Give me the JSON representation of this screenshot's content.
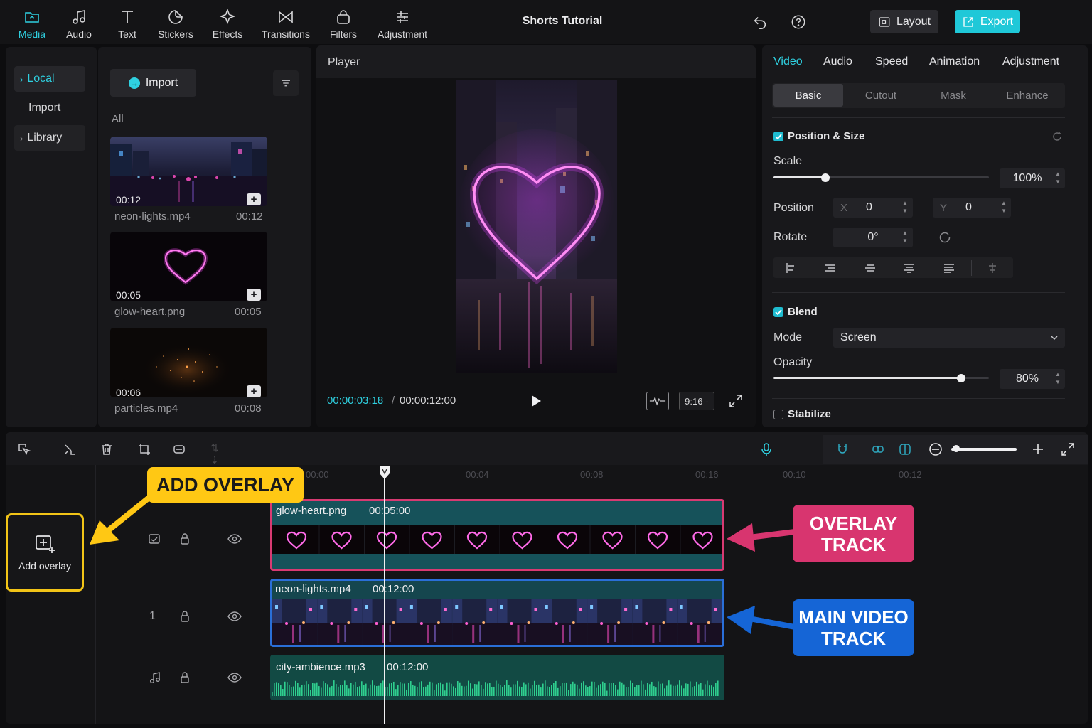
{
  "toolbar": {
    "items": [
      {
        "label": "Media",
        "icon": "folder-icon"
      },
      {
        "label": "Audio",
        "icon": "music-note-icon"
      },
      {
        "label": "Text",
        "icon": "text-icon"
      },
      {
        "label": "Stickers",
        "icon": "sticker-icon"
      },
      {
        "label": "Effects",
        "icon": "sparkle-icon"
      },
      {
        "label": "Transitions",
        "icon": "bowtie-icon"
      },
      {
        "label": "Filters",
        "icon": "filter-icon"
      },
      {
        "label": "Adjustment",
        "icon": "sliders-icon"
      }
    ],
    "title": "Shorts Tutorial",
    "layout_label": "Layout",
    "export_label": "Export"
  },
  "media_sidebar": {
    "local": "Local",
    "import": "Import",
    "library": "Library"
  },
  "media_panel": {
    "import_button": "Import",
    "filter_label": "All",
    "items": [
      {
        "thumb_time": "00:12",
        "name": "neon-lights.mp4",
        "duration": "00:12"
      },
      {
        "thumb_time": "00:05",
        "name": "glow-heart.png",
        "duration": "00:05"
      },
      {
        "thumb_time": "00:06",
        "name": "particles.mp4",
        "duration": "00:08"
      }
    ]
  },
  "player": {
    "title": "Player",
    "current_time": "00:00:03:18",
    "separator": "/",
    "total_time": "00:00:12:00",
    "ratio": "9:16"
  },
  "properties": {
    "tabs": [
      "Video",
      "Audio",
      "Speed",
      "Animation",
      "Adjustment"
    ],
    "subtabs": [
      "Basic",
      "Cutout",
      "Mask",
      "Enhance"
    ],
    "position_size": "Position & Size",
    "scale_label": "Scale",
    "scale_value": "100%",
    "scale_fraction": 0.24,
    "position_label": "Position",
    "x_label": "X",
    "x_value": "0",
    "y_label": "Y",
    "y_value": "0",
    "rotate_label": "Rotate",
    "rotate_value": "0°",
    "blend": "Blend",
    "mode_label": "Mode",
    "mode_value": "Screen",
    "opacity_label": "Opacity",
    "opacity_value": "80%",
    "opacity_fraction": 0.87,
    "stabilize": "Stabilize"
  },
  "timeline": {
    "ruler": [
      "00:00",
      "00:04",
      "00:08",
      "00:16",
      "00:10",
      "00:12"
    ],
    "add_overlay_label": "Add overlay",
    "main_track_number": "1",
    "clips": [
      {
        "name": "glow-heart.png",
        "duration": "00:05:00"
      },
      {
        "name": "neon-lights.mp4",
        "duration": "00:12:00"
      },
      {
        "name": "city-ambience.mp3",
        "duration": "00:12:00"
      }
    ]
  },
  "callouts": {
    "add_overlay": "ADD OVERLAY",
    "overlay_track": [
      "OVERLAY",
      "TRACK"
    ],
    "main_track": [
      "MAIN VIDEO",
      "TRACK"
    ]
  },
  "colors": {
    "accent": "#2fd0e0",
    "overlay_clip_border": "#d83a72",
    "main_clip_border": "#2a6fd8",
    "callout_yellow": "#ffc814",
    "callout_pink": "#d8356f",
    "callout_blue": "#1565d6"
  }
}
